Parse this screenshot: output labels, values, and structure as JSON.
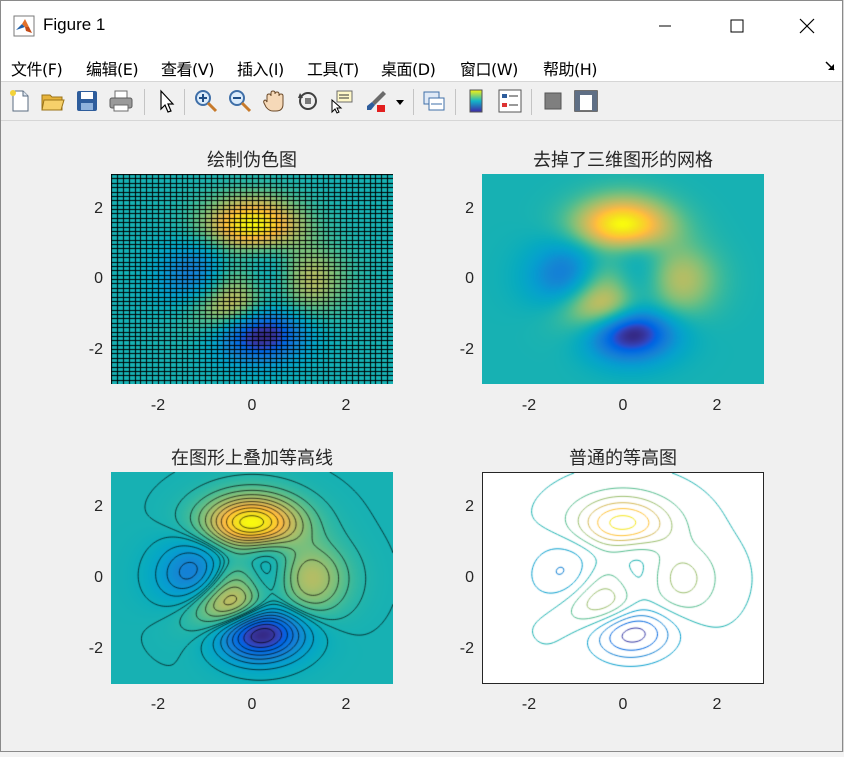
{
  "window": {
    "title": "Figure 1"
  },
  "menu": {
    "items": [
      "文件(F)",
      "编辑(E)",
      "查看(V)",
      "插入(I)",
      "工具(T)",
      "桌面(D)",
      "窗口(W)",
      "帮助(H)"
    ]
  },
  "toolbar": {
    "icons": [
      "new-figure-icon",
      "open-file-icon",
      "save-icon",
      "print-icon",
      "edit-plot-icon",
      "zoom-in-icon",
      "zoom-out-icon",
      "pan-icon",
      "rotate-3d-icon",
      "data-cursor-icon",
      "brush-icon",
      "link-plot-icon",
      "colorbar-icon",
      "legend-icon",
      "hide-plot-tools-icon",
      "show-plot-tools-icon"
    ]
  },
  "colors": {
    "parula_bg": "#13b5c8",
    "yellow": "#f9f30f",
    "dark_blue": "#3e26a8"
  },
  "chart_data": [
    {
      "type": "heatmap",
      "title": "绘制伪色图",
      "function": "peaks",
      "grid": true,
      "xlim": [
        -3,
        3
      ],
      "ylim": [
        -3,
        3
      ],
      "xticks": [
        "-2",
        "0",
        "2"
      ],
      "yticks": [
        "2",
        "0",
        "-2"
      ]
    },
    {
      "type": "heatmap",
      "title": "去掉了三维图形的网格",
      "function": "peaks",
      "grid": false,
      "shading": "interp",
      "xlim": [
        -3,
        3
      ],
      "ylim": [
        -3,
        3
      ],
      "xticks": [
        "-2",
        "0",
        "2"
      ],
      "yticks": [
        "2",
        "0",
        "-2"
      ]
    },
    {
      "type": "heatmap",
      "title": "在图形上叠加等高线",
      "function": "peaks",
      "overlay": "contour",
      "contour_color": "#000000",
      "xlim": [
        -3,
        3
      ],
      "ylim": [
        -3,
        3
      ],
      "xticks": [
        "-2",
        "0",
        "2"
      ],
      "yticks": [
        "2",
        "0",
        "-2"
      ]
    },
    {
      "type": "line",
      "title": "普通的等高图",
      "function": "peaks",
      "plot": "contour",
      "xlim": [
        -3,
        3
      ],
      "ylim": [
        -3,
        3
      ],
      "xticks": [
        "-2",
        "0",
        "2"
      ],
      "yticks": [
        "2",
        "0",
        "-2"
      ]
    }
  ]
}
